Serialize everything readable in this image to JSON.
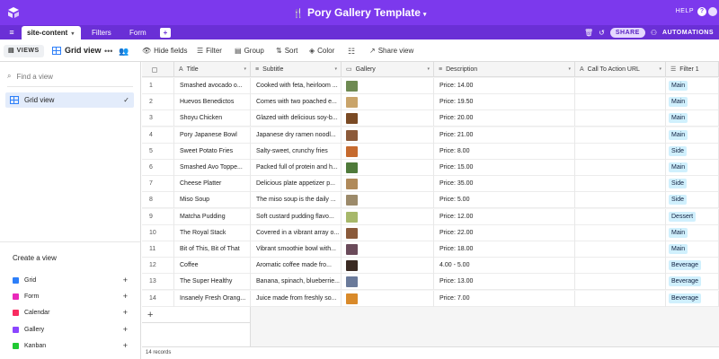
{
  "app": {
    "base_title": "Pory Gallery Template",
    "help_label": "HELP",
    "help_icon": "?"
  },
  "tabs": {
    "items": [
      {
        "label": "site-content"
      },
      {
        "label": "Filters"
      },
      {
        "label": "Form"
      }
    ],
    "add_label": "+",
    "share_label": "SHARE",
    "automations_label": "AUTOMATIONS"
  },
  "toolbar": {
    "views_label": "VIEWS",
    "view_name": "Grid view",
    "hide_fields": "Hide fields",
    "filter": "Filter",
    "group": "Group",
    "sort": "Sort",
    "color": "Color",
    "share_view": "Share view"
  },
  "sidebar": {
    "find_placeholder": "Find a view",
    "views": [
      {
        "label": "Grid view",
        "selected": true
      }
    ],
    "create_title": "Create a view",
    "create_items": [
      {
        "label": "Grid",
        "color": "#2d7ff9"
      },
      {
        "label": "Form",
        "color": "#e929ba"
      },
      {
        "label": "Calendar",
        "color": "#f82b60"
      },
      {
        "label": "Gallery",
        "color": "#8b46ff"
      },
      {
        "label": "Kanban",
        "color": "#20c933"
      }
    ]
  },
  "grid": {
    "columns": [
      {
        "label": "Title",
        "icon": "A"
      },
      {
        "label": "Subtitle",
        "icon": "≡"
      },
      {
        "label": "Gallery",
        "icon": "▭"
      },
      {
        "label": "Description",
        "icon": "≡"
      },
      {
        "label": "Call To Action URL",
        "icon": "A"
      },
      {
        "label": "Filter 1",
        "icon": "☰"
      }
    ],
    "rows": [
      {
        "n": "1",
        "title": "Smashed avocado o...",
        "subtitle": "Cooked with feta, heirloom ...",
        "desc": "Price: 14.00",
        "tag": "Main",
        "thumb": "#6e8a52"
      },
      {
        "n": "2",
        "title": "Huevos Benedictos",
        "subtitle": "Comes with two poached e...",
        "desc": "Price: 19.50",
        "tag": "Main",
        "thumb": "#c9a46a"
      },
      {
        "n": "3",
        "title": "Shoyu Chicken",
        "subtitle": "Glazed with delicious soy-b...",
        "desc": "Price: 20.00",
        "tag": "Main",
        "thumb": "#7a4a24"
      },
      {
        "n": "4",
        "title": "Pory Japanese Bowl",
        "subtitle": "Japanese dry ramen noodl...",
        "desc": "Price: 21.00",
        "tag": "Main",
        "thumb": "#8c5a3a"
      },
      {
        "n": "5",
        "title": "Sweet Potato Fries",
        "subtitle": "Salty-sweet, crunchy fries",
        "desc": "Price: 8.00",
        "tag": "Side",
        "thumb": "#c66a2e"
      },
      {
        "n": "6",
        "title": "Smashed Avo Toppe...",
        "subtitle": "Packed full of protein and h...",
        "desc": "Price: 15.00",
        "tag": "Main",
        "thumb": "#4f7a3a"
      },
      {
        "n": "7",
        "title": "Cheese Platter",
        "subtitle": "Delicious plate appetizer p...",
        "desc": "Price: 35.00",
        "tag": "Side",
        "thumb": "#b08a5a"
      },
      {
        "n": "8",
        "title": "Miso Soup",
        "subtitle": "The miso soup is the daily ...",
        "desc": "Price: 5.00",
        "tag": "Side",
        "thumb": "#9c8a6a"
      },
      {
        "n": "9",
        "title": "Matcha Pudding",
        "subtitle": "Soft custard pudding flavo...",
        "desc": "Price: 12.00",
        "tag": "Dessert",
        "thumb": "#a7b86a"
      },
      {
        "n": "10",
        "title": "The Royal Stack",
        "subtitle": "Covered in a vibrant array o...",
        "desc": "Price: 22.00",
        "tag": "Main",
        "thumb": "#8a5a3a"
      },
      {
        "n": "11",
        "title": "Bit of This, Bit of That",
        "subtitle": "Vibrant smoothie bowl with...",
        "desc": "Price: 18.00",
        "tag": "Main",
        "thumb": "#6a4a5a"
      },
      {
        "n": "12",
        "title": "Coffee",
        "subtitle": "Aromatic coffee made fro...",
        "desc": "4.00 - 5.00",
        "tag": "Beverage",
        "thumb": "#3a2a22"
      },
      {
        "n": "13",
        "title": "The Super Healthy",
        "subtitle": "Banana, spinach, blueberrie...",
        "desc": "Price: 13.00",
        "tag": "Beverage",
        "thumb": "#6a7a9a"
      },
      {
        "n": "14",
        "title": "Insanely Fresh Orang...",
        "subtitle": "Juice made from freshly so...",
        "desc": "Price: 7.00",
        "tag": "Beverage",
        "thumb": "#d98a2a"
      }
    ],
    "add_row_label": "+",
    "record_count": "14 records"
  }
}
